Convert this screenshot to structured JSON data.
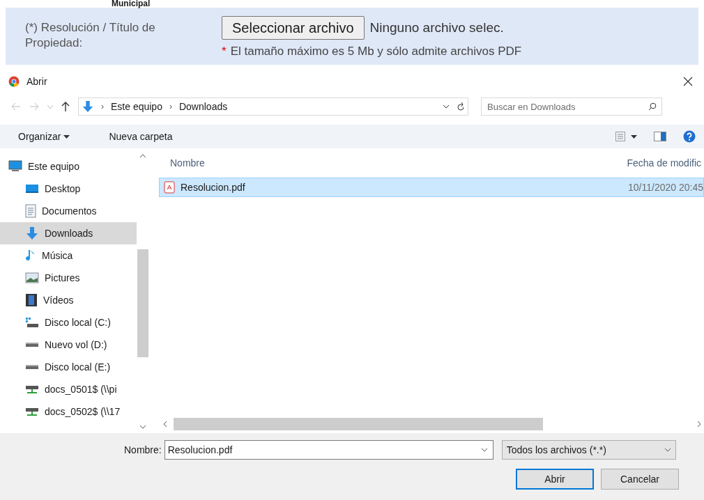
{
  "page_heading": "Municipal",
  "form": {
    "label": "(*) Resolución / Título de Propiedad:",
    "button": "Seleccionar archivo",
    "file_status": "Ninguno archivo selec.",
    "hint_mark": "*",
    "hint": "El tamaño máximo es 5 Mb y sólo admite archivos PDF"
  },
  "dialog": {
    "title": "Abrir",
    "breadcrumb": [
      {
        "separator": "›",
        "label": "Este equipo"
      },
      {
        "separator": "›",
        "label": "Downloads"
      }
    ],
    "search": {
      "placeholder": "Buscar en Downloads"
    },
    "toolbar": [
      {
        "label": "Organizar",
        "dropdown": true
      },
      {
        "label": "Nueva carpeta",
        "dropdown": false
      }
    ],
    "sidebar": [
      {
        "label": "Este equipo",
        "kind": "computer",
        "selected": false,
        "children": [
          {
            "label": "Desktop",
            "kind": "desktop",
            "selected": false
          },
          {
            "label": "Documentos",
            "kind": "document",
            "selected": false
          },
          {
            "label": "Downloads",
            "kind": "download",
            "selected": true
          },
          {
            "label": "Música",
            "kind": "music",
            "selected": false
          },
          {
            "label": "Pictures",
            "kind": "picture",
            "selected": false
          },
          {
            "label": "Vídeos",
            "kind": "video",
            "selected": false
          },
          {
            "label": "Disco local (C:)",
            "kind": "system-drive",
            "selected": false
          },
          {
            "label": "Nuevo vol (D:)",
            "kind": "drive",
            "selected": false
          },
          {
            "label": "Disco local (E:)",
            "kind": "drive",
            "selected": false
          },
          {
            "label": "docs_0501$ (\\\\pi",
            "kind": "network-drive",
            "selected": false
          },
          {
            "label": "docs_0502$ (\\\\17",
            "kind": "network-drive",
            "selected": false
          }
        ]
      }
    ],
    "columns": [
      "Nombre",
      "Fecha de modific"
    ],
    "files": [
      {
        "name": "Resolucion.pdf",
        "date": "10/11/2020 20:45",
        "selected": true
      }
    ],
    "filename_label": "Nombre:",
    "filename": "Resolucion.pdf",
    "filter": "Todos los archivos (*.*)",
    "buttons": [
      {
        "label": "Abrir",
        "default": true
      },
      {
        "label": "Cancelar",
        "default": false
      }
    ]
  }
}
